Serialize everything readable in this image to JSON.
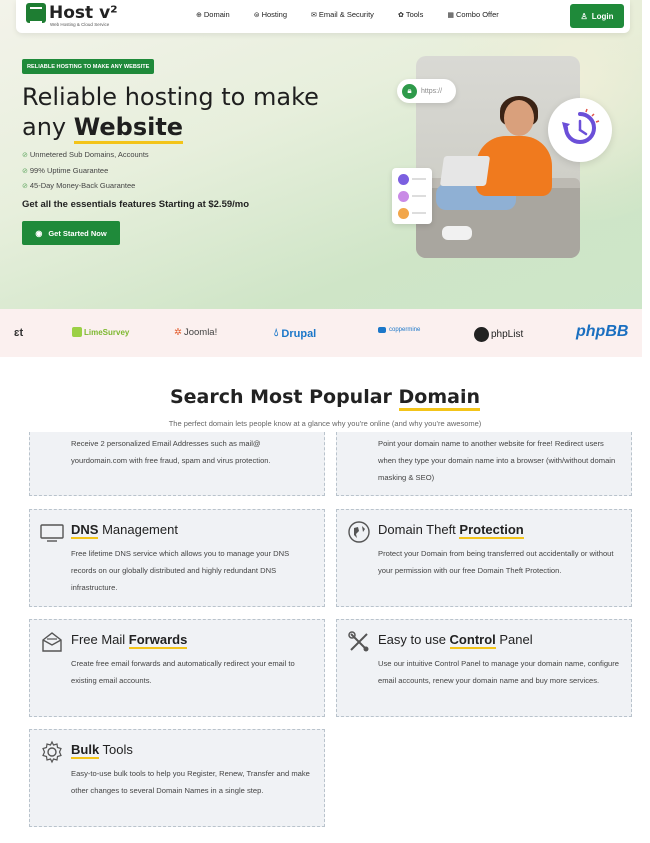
{
  "nav": {
    "logo_text": "Host v²",
    "logo_tagline": "Web Hosting & Cloud Service",
    "menu": [
      {
        "label": "Domain",
        "icon": "globe-icon"
      },
      {
        "label": "Hosting",
        "icon": "database-icon"
      },
      {
        "label": "Email & Security",
        "icon": "mail-icon"
      },
      {
        "label": "Tools",
        "icon": "gear-icon"
      },
      {
        "label": "Combo Offer",
        "icon": "gift-icon"
      }
    ],
    "login_label": "Login"
  },
  "hero": {
    "badge": "RELIABLE HOSTING TO MAKE ANY WEBSITE",
    "title_line1": "Reliable hosting to make",
    "title_line2_prefix": "any ",
    "title_line2_highlight": "Website",
    "features": [
      "Unmetered Sub Domains, Accounts",
      "99% Uptime Guarantee",
      "45-Day Money-Back Guarantee"
    ],
    "essentials": "Get all the essentials features Starting at $2.59/mo",
    "cta_label": "Get Started Now",
    "url_pill": "https://"
  },
  "partners": [
    {
      "name": "LimeSurvey",
      "color": "#7db82f"
    },
    {
      "name": "Joomla!",
      "color": "#444444"
    },
    {
      "name": "Drupal",
      "color": "#1b77c9"
    },
    {
      "name": "coppermine",
      "color": "#1b77c9"
    },
    {
      "name": "phpList",
      "color": "#222222"
    },
    {
      "name": "phpBB",
      "color": "#1a6fc0"
    }
  ],
  "partners_cut": "ɛt",
  "section": {
    "title_prefix": "Search Most Popular ",
    "title_highlight": "Domain",
    "subtitle": "The perfect domain lets people know at a glance why you're online (and why you're awesome)"
  },
  "cards": {
    "email_desc": "Receive 2 personalized Email Addresses such as mail@ yourdomain.com with free fraud, spam and virus protection.",
    "forward_desc": "Point your domain name to another website for free! Redirect users when they type your domain name into a browser (with/without domain masking & SEO)",
    "dns_title_hl": "DNS",
    "dns_title_rest": " Management",
    "dns_desc": "Free lifetime DNS service which allows you to manage your DNS records on our globally distributed and highly redundant DNS infrastructure.",
    "theft_title_pre": "Domain Theft ",
    "theft_title_hl": "Protection",
    "theft_desc": "Protect your Domain from being transferred out accidentally or without your permission with our free Domain Theft Protection.",
    "mail_title_pre": "Free Mail ",
    "mail_title_hl": "Forwards",
    "mail_desc": "Create free email forwards and automatically redirect your email to existing email accounts.",
    "cp_title_pre": "Easy to use ",
    "cp_title_hl": "Control",
    "cp_title_post": " Panel",
    "cp_desc": "Use our intuitive Control Panel to manage your domain name, configure email accounts, renew your domain name and buy more services.",
    "bulk_title_hl": "Bulk",
    "bulk_title_post": " Tools",
    "bulk_desc": "Easy-to-use bulk tools to help you Register, Renew, Transfer and make other changes to several Domain Names in a single step."
  }
}
